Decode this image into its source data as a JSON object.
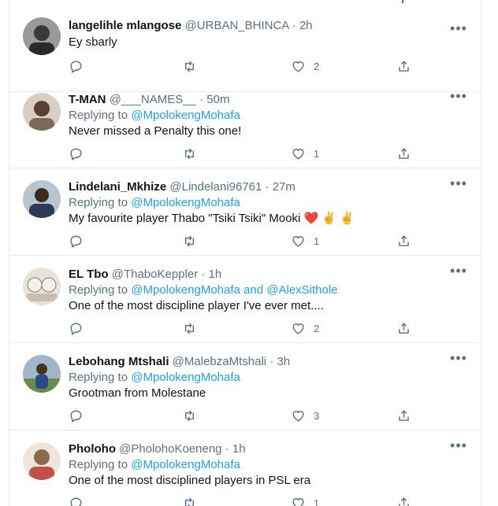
{
  "tweets": [
    {
      "name": "langelihle mlangose",
      "handle": "@URBAN_BHINCA",
      "time": "2h",
      "reply_prefix": "",
      "reply_to": "",
      "text": "Ey sbarly",
      "likes": "2",
      "avatar_color": "#3a3a3a"
    },
    {
      "name": "T-MAN",
      "handle": "@___NAMES__",
      "time": "50m",
      "reply_prefix": "Replying to",
      "reply_to": "@MpolokengMohafa",
      "text": "Never missed a Penalty this one!",
      "likes": "1",
      "avatar_color": "#5a4030"
    },
    {
      "name": "Lindelani_Mkhize",
      "handle": "@Lindelani96761",
      "time": "27m",
      "reply_prefix": "Replying to",
      "reply_to": "@MpolokengMohafa",
      "text": "My favourite player Thabo \"Tsiki Tsiki\" Mooki ❤️ ✌️ ✌️",
      "likes": "1",
      "avatar_color": "#2c3a55"
    },
    {
      "name": "EL Tbo",
      "handle": "@ThaboKeppler",
      "time": "1h",
      "reply_prefix": "Replying to",
      "reply_to": "@MpolokengMohafa and @AlexSithole",
      "text": "One of the most discipline player I've ever met....",
      "likes": "2",
      "avatar_color": "#c9bfb0"
    },
    {
      "name": "Lebohang Mtshali",
      "handle": "@MalebzaMtshali",
      "time": "3h",
      "reply_prefix": "Replying to",
      "reply_to": "@MpolokengMohafa",
      "text": "Grootman from Molestane",
      "likes": "3",
      "avatar_color": "#6a8a4a"
    },
    {
      "name": "Pholoho",
      "handle": "@PholohoKoeneng",
      "time": "1h",
      "reply_prefix": "Replying to",
      "reply_to": "@MpolokengMohafa",
      "text": "One of the most disciplined players in PSL era",
      "likes": "1",
      "avatar_color": "#8a6a50"
    }
  ],
  "colors": {
    "accent": "#1da1f2",
    "secondary_text": "#5b7083",
    "border": "#e6ecf0"
  },
  "icons": {
    "reply": "reply-icon",
    "retweet": "retweet-icon",
    "like": "heart-icon",
    "share": "share-icon",
    "more": "more-icon"
  }
}
